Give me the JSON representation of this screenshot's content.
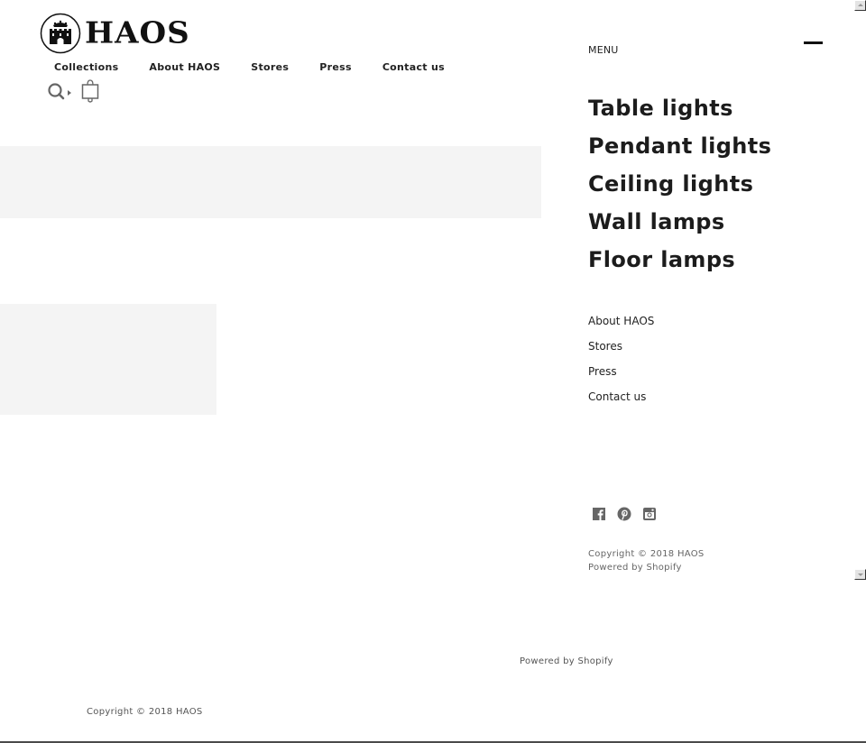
{
  "brand": {
    "name": "HAOS",
    "emblem_icon": "castle-crest-icon"
  },
  "header": {
    "nav": [
      {
        "label": "Collections"
      },
      {
        "label": "About HAOS"
      },
      {
        "label": "Stores"
      },
      {
        "label": "Press"
      },
      {
        "label": "Contact us"
      }
    ],
    "icons": {
      "search": "search-icon",
      "cart": "shopping-bag-icon"
    }
  },
  "menu": {
    "label": "MENU",
    "close_icon": "close-dash-icon",
    "primary": [
      {
        "label": "Table lights"
      },
      {
        "label": "Pendant lights"
      },
      {
        "label": "Ceiling lights"
      },
      {
        "label": "Wall lamps"
      },
      {
        "label": "Floor lamps"
      }
    ],
    "secondary": [
      {
        "label": "About HAOS"
      },
      {
        "label": "Stores"
      },
      {
        "label": "Press"
      },
      {
        "label": "Contact us"
      }
    ],
    "social": [
      {
        "name": "facebook-icon"
      },
      {
        "name": "pinterest-icon"
      },
      {
        "name": "instagram-icon"
      }
    ],
    "copyright": "Copyright © 2018 HAOS",
    "powered_by": "Powered by Shopify"
  },
  "footer": {
    "powered_by": "Powered by Shopify",
    "copyright": "Copyright © 2018 HAOS"
  },
  "colors": {
    "text": "#1c1c1c",
    "placeholder": "#f4f4f4",
    "muted": "#666666"
  }
}
